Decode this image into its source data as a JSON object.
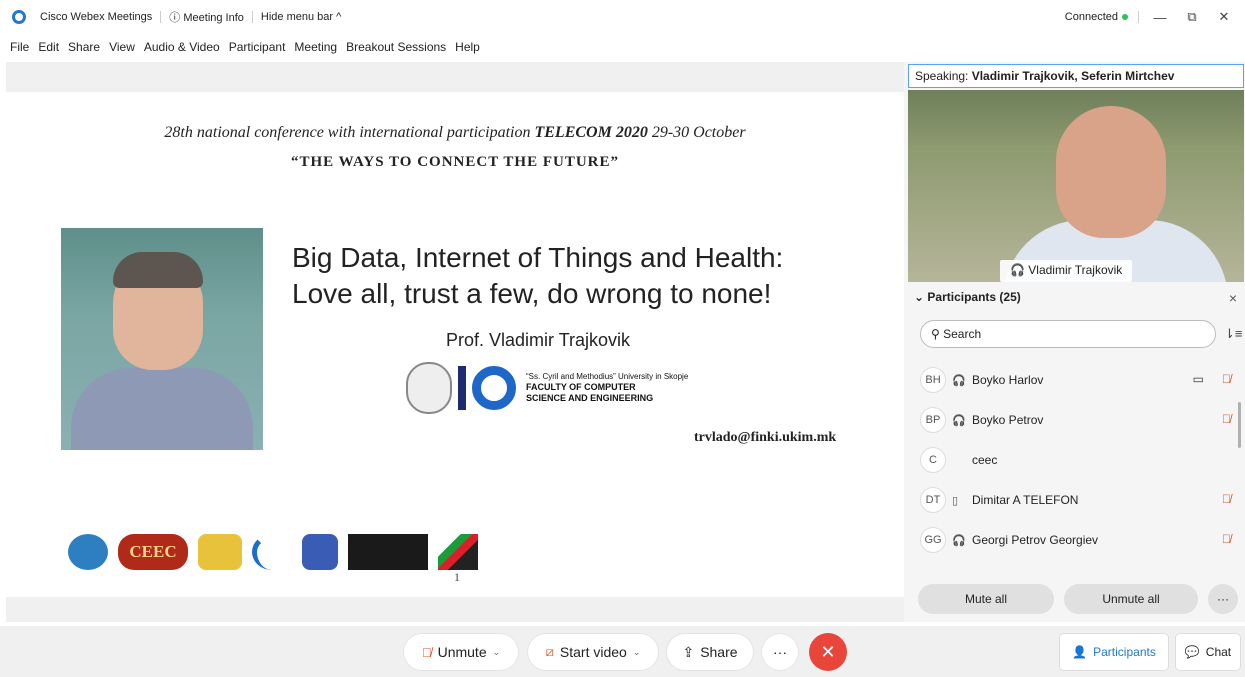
{
  "titlebar": {
    "app_name": "Cisco Webex Meetings",
    "meeting_info": "Meeting Info",
    "hide_menu": "Hide menu bar ^",
    "status": "Connected",
    "minimize": "—",
    "restore": "⧉",
    "close": "✕"
  },
  "menubar": {
    "items": [
      "File",
      "Edit",
      "Share",
      "View",
      "Audio & Video",
      "Participant",
      "Meeting",
      "Breakout Sessions",
      "Help"
    ]
  },
  "slide": {
    "conf_line_pre": "28th national conference with international participation ",
    "conf_line_bold": "TELECOM 2020",
    "conf_line_post": "   29-30 October",
    "motto": "“THE WAYS TO CONNECT THE FUTURE”",
    "title_line1": "Big Data, Internet of Things and Health:",
    "title_line2": "Love all, trust a few, do wrong to none!",
    "presenter": "Prof. Vladimir Trajkovik",
    "uni_line1": "“Ss. Cyril and Methodius” University in Skopje",
    "uni_line2": "FACULTY OF COMPUTER",
    "uni_line3": "SCIENCE AND ENGINEERING",
    "email": "trvlado@finki.ukim.mk",
    "ceec_logo": "CEEC",
    "page_number": "1"
  },
  "panel": {
    "speaking_label": "Speaking: ",
    "speaking_names": "Vladimir Trajkovik, Seferin Mirtchev",
    "video_name": "Vladimir Trajkovik",
    "participants_title": "Participants (25)",
    "search_placeholder": "Search",
    "participants": [
      {
        "initials": "BH",
        "name": "Boyko Harlov",
        "device": "audio",
        "camera": true,
        "muted": true
      },
      {
        "initials": "BP",
        "name": "Boyko Petrov",
        "device": "audio",
        "camera": false,
        "muted": true
      },
      {
        "initials": "C",
        "name": "ceec",
        "device": "",
        "camera": false,
        "muted": false
      },
      {
        "initials": "DT",
        "name": "Dimitar A TELEFON",
        "device": "phone",
        "camera": false,
        "muted": true
      },
      {
        "initials": "GG",
        "name": "Georgi Petrov Georgiev",
        "device": "audio",
        "camera": false,
        "muted": true
      }
    ],
    "mute_all": "Mute all",
    "unmute_all": "Unmute all",
    "more": "···"
  },
  "bottombar": {
    "unmute": "Unmute",
    "start_video": "Start video",
    "share": "Share",
    "more": "···",
    "end": "✕",
    "participants": "Participants",
    "chat": "Chat"
  }
}
